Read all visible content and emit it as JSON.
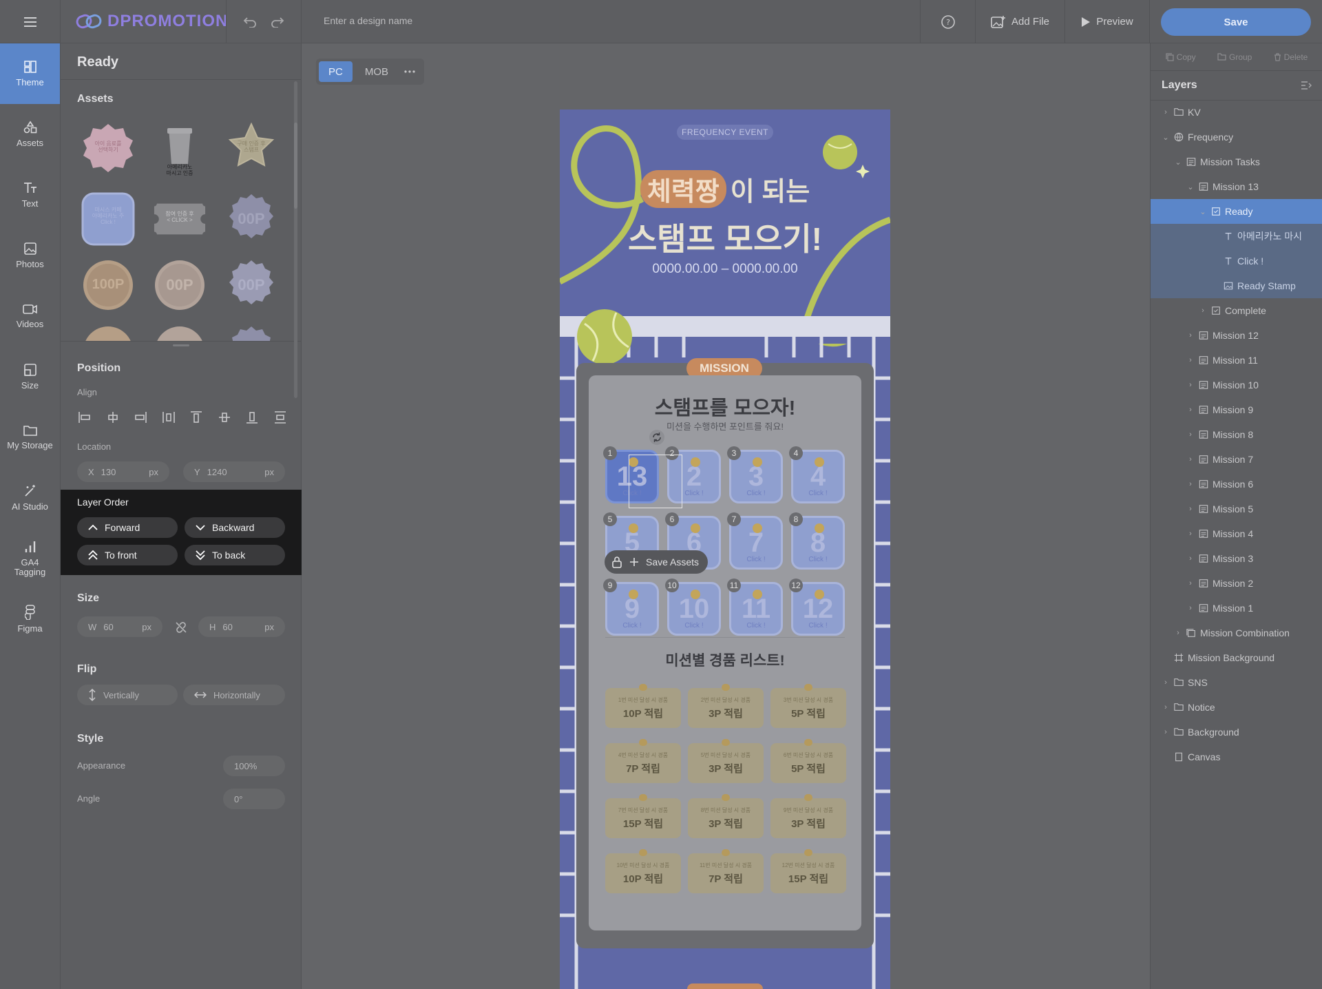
{
  "brand": {
    "name": "DPROMOTION"
  },
  "header": {
    "design_name_placeholder": "Enter a design name",
    "add_file": "Add File",
    "preview": "Preview",
    "save": "Save"
  },
  "rail": [
    {
      "label": "Theme"
    },
    {
      "label": "Assets"
    },
    {
      "label": "Text"
    },
    {
      "label": "Photos"
    },
    {
      "label": "Videos"
    },
    {
      "label": "Size"
    },
    {
      "label": "My Storage"
    },
    {
      "label": "AI Studio"
    },
    {
      "label": "GA4 Tagging"
    },
    {
      "label": "Figma"
    }
  ],
  "panel": {
    "title": "Ready",
    "assets_heading": "Assets",
    "asset_labels": [
      "아이 음료를 \n선택하기",
      "아메리카노\n마시고 인증",
      "구매 인증 후\n스탬프",
      "마시스 카페\n아메리카노 주\nClick !",
      "참여 인증 후\n< CLICK >",
      "00P",
      "100P",
      "00P",
      "00P"
    ],
    "position_heading": "Position",
    "align_label": "Align",
    "location_label": "Location",
    "x_label": "X",
    "x_value": "130",
    "y_label": "Y",
    "y_value": "1240",
    "unit": "px",
    "size_heading": "Size",
    "w_label": "W",
    "w_value": "60",
    "h_label": "H",
    "h_value": "60",
    "flip_heading": "Flip",
    "flip_vertical": "Vertically",
    "flip_horizontal": "Horizontally",
    "style_heading": "Style",
    "appearance_label": "Appearance",
    "appearance_value": "100%",
    "angle_label": "Angle",
    "angle_value": "0°"
  },
  "layer_order": {
    "title": "Layer Order",
    "forward": "Forward",
    "backward": "Backward",
    "to_front": "To front",
    "to_back": "To back"
  },
  "canvas": {
    "tabs": [
      "PC",
      "MOB"
    ],
    "active_tab": "PC",
    "badge": "FREQUENCY  EVENT",
    "hero_highlight": "체력짱",
    "hero_line1_rest": "이 되는",
    "hero_line2": "스탬프 모으기!",
    "date_range": "0000.00.00 – 0000.00.00",
    "mission_tag": "MISSION",
    "card_title": "스탬프를 모으자!",
    "card_subtitle": "미션을 수행하면 포인트를 줘요!",
    "stamps": [
      {
        "num": "1",
        "big": "13"
      },
      {
        "num": "2",
        "big": "2"
      },
      {
        "num": "3",
        "big": "3"
      },
      {
        "num": "4",
        "big": "4"
      },
      {
        "num": "5",
        "big": "5"
      },
      {
        "num": "6",
        "big": "6"
      },
      {
        "num": "7",
        "big": "7"
      },
      {
        "num": "8",
        "big": "8"
      },
      {
        "num": "9",
        "big": "9"
      },
      {
        "num": "10",
        "big": "10"
      },
      {
        "num": "11",
        "big": "11"
      },
      {
        "num": "12",
        "big": "12"
      }
    ],
    "stamp_click": "Click !",
    "save_assets": "Save Assets",
    "prize_title": "미션별 경품 리스트!",
    "prizes": [
      {
        "small": "1번 미션 달성 시 경품",
        "pt": "10P 적립"
      },
      {
        "small": "2번 미션 달성 시 경품",
        "pt": "3P 적립"
      },
      {
        "small": "3번 미션 달성 시 경품",
        "pt": "5P 적립"
      },
      {
        "small": "4번 미션 달성 시 경품",
        "pt": "7P 적립"
      },
      {
        "small": "5번 미션 달성 시 경품",
        "pt": "3P 적립"
      },
      {
        "small": "6번 미션 달성 시 경품",
        "pt": "5P 적립"
      },
      {
        "small": "7번 미션 달성 시 경품",
        "pt": "15P 적립"
      },
      {
        "small": "8번 미션 달성 시 경품",
        "pt": "3P 적립"
      },
      {
        "small": "9번 미션 달성 시 경품",
        "pt": "3P 적립"
      },
      {
        "small": "10번 미션 달성 시 경품",
        "pt": "10P 적립"
      },
      {
        "small": "11번 미션 달성 시 경품",
        "pt": "7P 적립"
      },
      {
        "small": "12번 미션 달성 시 경품",
        "pt": "15P 적립"
      }
    ]
  },
  "layers": {
    "toolbar": {
      "copy": "Copy",
      "group": "Group",
      "delete": "Delete"
    },
    "title": "Layers",
    "rows": [
      {
        "label": "KV",
        "icon": "folder-icon",
        "depth": 0,
        "caret": "›",
        "state": ""
      },
      {
        "label": "Frequency",
        "icon": "globe-icon",
        "depth": 0,
        "caret": "⌄",
        "state": ""
      },
      {
        "label": "Mission Tasks",
        "icon": "list-icon",
        "depth": 1,
        "caret": "⌄",
        "state": ""
      },
      {
        "label": "Mission 13",
        "icon": "list-icon",
        "depth": 2,
        "caret": "⌄",
        "state": ""
      },
      {
        "label": "Ready",
        "icon": "frame-icon",
        "depth": 3,
        "caret": "⌄",
        "state": "sel"
      },
      {
        "label": "아메리카노 마시",
        "icon": "text-icon",
        "depth": 4,
        "caret": "",
        "state": "seldim"
      },
      {
        "label": "Click !",
        "icon": "text-icon",
        "depth": 4,
        "caret": "",
        "state": "seldim"
      },
      {
        "label": "Ready Stamp",
        "icon": "image-icon",
        "depth": 4,
        "caret": "",
        "state": "seldim"
      },
      {
        "label": "Complete",
        "icon": "frame-icon",
        "depth": 3,
        "caret": "›",
        "state": ""
      },
      {
        "label": "Mission 12",
        "icon": "list-icon",
        "depth": 2,
        "caret": "›",
        "state": ""
      },
      {
        "label": "Mission 11",
        "icon": "list-icon",
        "depth": 2,
        "caret": "›",
        "state": ""
      },
      {
        "label": "Mission 10",
        "icon": "list-icon",
        "depth": 2,
        "caret": "›",
        "state": ""
      },
      {
        "label": "Mission 9",
        "icon": "list-icon",
        "depth": 2,
        "caret": "›",
        "state": ""
      },
      {
        "label": "Mission 8",
        "icon": "list-icon",
        "depth": 2,
        "caret": "›",
        "state": ""
      },
      {
        "label": "Mission 7",
        "icon": "list-icon",
        "depth": 2,
        "caret": "›",
        "state": ""
      },
      {
        "label": "Mission 6",
        "icon": "list-icon",
        "depth": 2,
        "caret": "›",
        "state": ""
      },
      {
        "label": "Mission 5",
        "icon": "list-icon",
        "depth": 2,
        "caret": "›",
        "state": ""
      },
      {
        "label": "Mission 4",
        "icon": "list-icon",
        "depth": 2,
        "caret": "›",
        "state": ""
      },
      {
        "label": "Mission 3",
        "icon": "list-icon",
        "depth": 2,
        "caret": "›",
        "state": ""
      },
      {
        "label": "Mission 2",
        "icon": "list-icon",
        "depth": 2,
        "caret": "›",
        "state": ""
      },
      {
        "label": "Mission 1",
        "icon": "list-icon",
        "depth": 2,
        "caret": "›",
        "state": ""
      },
      {
        "label": "Mission Combination",
        "icon": "stack-icon",
        "depth": 1,
        "caret": "›",
        "state": ""
      },
      {
        "label": "Mission Background",
        "icon": "frame-corner-icon",
        "depth": 0,
        "caret": "",
        "state": ""
      },
      {
        "label": "SNS",
        "icon": "folder-icon",
        "depth": 0,
        "caret": "›",
        "state": ""
      },
      {
        "label": "Notice",
        "icon": "folder-icon",
        "depth": 0,
        "caret": "›",
        "state": ""
      },
      {
        "label": "Background",
        "icon": "folder-icon",
        "depth": 0,
        "caret": "›",
        "state": ""
      },
      {
        "label": "Canvas",
        "icon": "page-icon",
        "depth": 0,
        "caret": "",
        "state": ""
      }
    ]
  },
  "colors": {
    "accent": "#5b86c9",
    "art_bg": "#5f68a6",
    "highlight": "#c78a5e"
  }
}
